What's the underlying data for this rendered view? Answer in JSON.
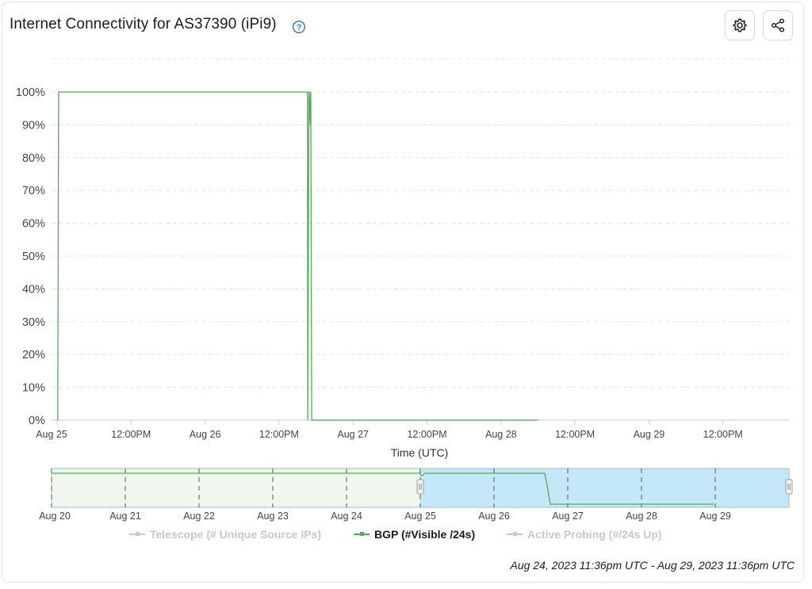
{
  "header": {
    "title": "Internet Connectivity for AS37390 (iPi9)"
  },
  "colors": {
    "bgp": "#4caf50",
    "inactive_legend": "#c8c8c8",
    "navigator_selected": "#c5e8f8",
    "navigator_unselected": "#eef8ec",
    "navigator_border": "#a8b8c8"
  },
  "icons": {
    "help": "question-circle-icon",
    "settings": "gear-icon",
    "share": "share-icon"
  },
  "chart_data": {
    "type": "line",
    "xlabel": "Time (UTC)",
    "ylabel": "",
    "ylim": [
      0,
      100
    ],
    "y_ticks": [
      "0%",
      "10%",
      "20%",
      "30%",
      "40%",
      "50%",
      "60%",
      "70%",
      "80%",
      "90%",
      "100%"
    ],
    "x_ticks": [
      "Aug 25",
      "12:00PM",
      "Aug 26",
      "12:00PM",
      "Aug 27",
      "12:00PM",
      "Aug 28",
      "12:00PM",
      "Aug 29",
      "12:00PM"
    ],
    "grid": true,
    "series": [
      {
        "name": "BGP (#Visible /24s)",
        "color": "#4caf50",
        "x_hours": [
          0.1,
          0.25,
          0.45,
          40.6,
          40.65,
          40.85,
          40.9,
          41.05,
          41.15,
          41.3,
          78
        ],
        "values": [
          0,
          100,
          100,
          100,
          0,
          100,
          100,
          90,
          100,
          0,
          0
        ]
      }
    ],
    "navigator": {
      "x_ticks": [
        "Aug 20",
        "Aug 21",
        "Aug 22",
        "Aug 23",
        "Aug 24",
        "Aug 25",
        "Aug 26",
        "Aug 27",
        "Aug 28",
        "Aug 29"
      ],
      "selected_range": [
        "Aug 25",
        "Aug 29"
      ]
    }
  },
  "legend": {
    "telescope": "Telescope (# Unique Source IPs)",
    "bgp": "BGP (#Visible /24s)",
    "active_probing": "Active Probing (#/24s Up)"
  },
  "footer": {
    "range": "Aug 24, 2023 11:36pm UTC - Aug 29, 2023 11:36pm UTC"
  }
}
